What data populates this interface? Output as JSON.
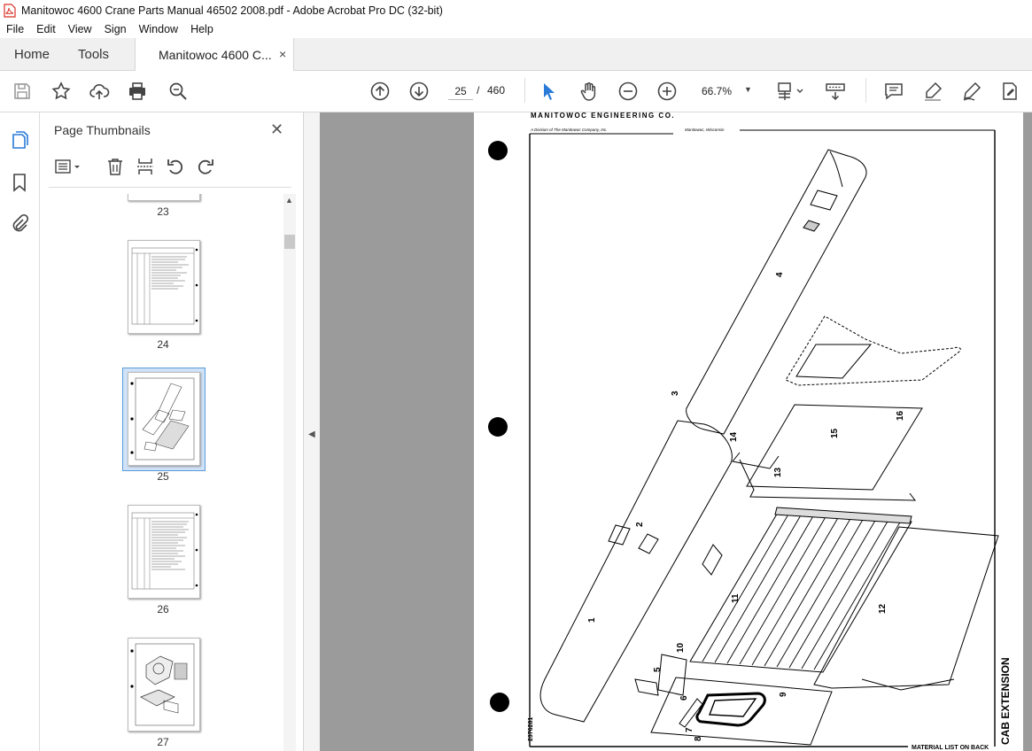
{
  "window": {
    "title": "Manitowoc 4600 Crane Parts Manual 46502 2008.pdf - Adobe Acrobat Pro DC (32-bit)"
  },
  "menu": [
    "File",
    "Edit",
    "View",
    "Sign",
    "Window",
    "Help"
  ],
  "tabs": {
    "home": "Home",
    "tools": "Tools",
    "document": "Manitowoc 4600 C...",
    "close": "×"
  },
  "toolbar": {
    "current_page": "25",
    "page_separator": "/",
    "total_pages": "460",
    "zoom": "66.7%"
  },
  "panel": {
    "title": "Page Thumbnails",
    "close": "✕",
    "thumbnails": [
      {
        "label": "23",
        "selected": false
      },
      {
        "label": "24",
        "selected": false
      },
      {
        "label": "25",
        "selected": true
      },
      {
        "label": "26",
        "selected": false
      },
      {
        "label": "27",
        "selected": false
      }
    ]
  },
  "document": {
    "header_company": "MANITOWOC ENGINEERING CO.",
    "header_division": "A Division of The Manitowoc Company, Inc.",
    "header_city": "Manitowoc, Wisconsin",
    "drawing_title": "CAB EXTENSION",
    "drawing_number": "2376281",
    "footer_note": "MATERIAL LIST ON BACK",
    "part_labels": [
      "1",
      "2",
      "3",
      "4",
      "5",
      "6",
      "7",
      "8",
      "9",
      "10",
      "11",
      "12",
      "13",
      "14",
      "15",
      "16"
    ]
  },
  "colors": {
    "accent": "#2a7bd8",
    "canvas_bg": "#9b9b9b",
    "pdf_red": "#d93025"
  }
}
